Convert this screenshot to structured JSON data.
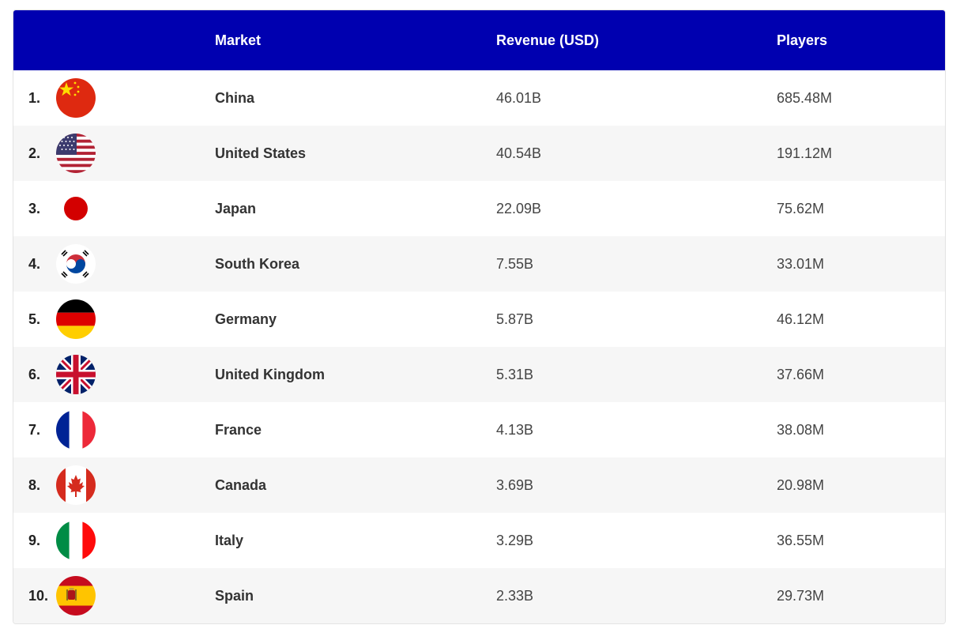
{
  "header": {
    "rank": "",
    "market": "Market",
    "revenue": "Revenue (USD)",
    "players": "Players"
  },
  "rows": [
    {
      "rank": "1.",
      "market": "China",
      "revenue": "46.01B",
      "players": "685.48M",
      "flag": "china-flag-icon"
    },
    {
      "rank": "2.",
      "market": "United States",
      "revenue": "40.54B",
      "players": "191.12M",
      "flag": "usa-flag-icon"
    },
    {
      "rank": "3.",
      "market": "Japan",
      "revenue": "22.09B",
      "players": "75.62M",
      "flag": "japan-flag-icon"
    },
    {
      "rank": "4.",
      "market": "South Korea",
      "revenue": "7.55B",
      "players": "33.01M",
      "flag": "south-korea-flag-icon"
    },
    {
      "rank": "5.",
      "market": "Germany",
      "revenue": "5.87B",
      "players": "46.12M",
      "flag": "germany-flag-icon"
    },
    {
      "rank": "6.",
      "market": "United Kingdom",
      "revenue": "5.31B",
      "players": "37.66M",
      "flag": "uk-flag-icon"
    },
    {
      "rank": "7.",
      "market": "France",
      "revenue": "4.13B",
      "players": "38.08M",
      "flag": "france-flag-icon"
    },
    {
      "rank": "8.",
      "market": "Canada",
      "revenue": "3.69B",
      "players": "20.98M",
      "flag": "canada-flag-icon"
    },
    {
      "rank": "9.",
      "market": "Italy",
      "revenue": "3.29B",
      "players": "36.55M",
      "flag": "italy-flag-icon"
    },
    {
      "rank": "10.",
      "market": "Spain",
      "revenue": "2.33B",
      "players": "29.73M",
      "flag": "spain-flag-icon"
    }
  ],
  "colors": {
    "header_bg": "#0000b0",
    "header_text": "#ffffff",
    "row_alt_bg": "#f6f6f6"
  }
}
